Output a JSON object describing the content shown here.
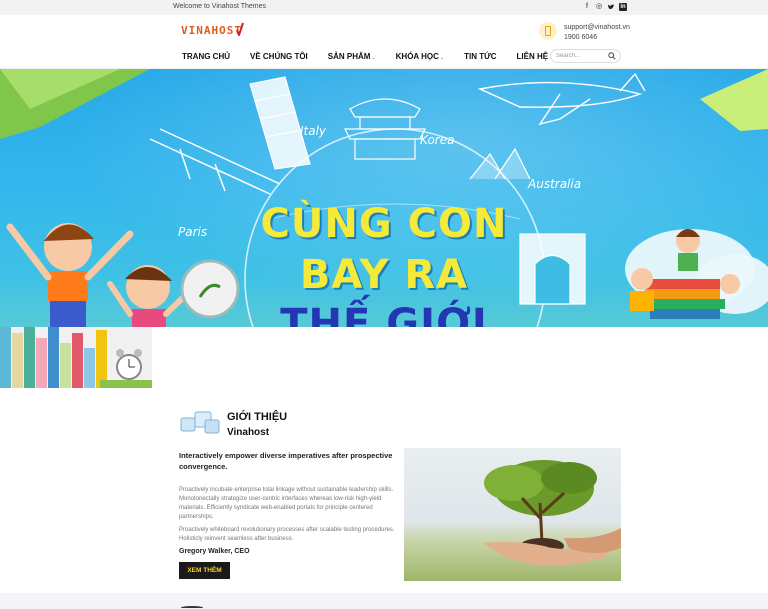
{
  "topbar": {
    "welcome": "Welcome to Vinahost Themes",
    "social": [
      {
        "icon": "facebook-icon",
        "glyph": "f"
      },
      {
        "icon": "instagram-icon",
        "glyph": "◎"
      },
      {
        "icon": "twitter-icon",
        "glyph": "🐦"
      },
      {
        "icon": "linkedin-icon",
        "glyph": "in"
      }
    ]
  },
  "header": {
    "logo_text": "VINAHOST",
    "contact": {
      "email": "support@vinahost.vn",
      "phone": "1900 6046",
      "icon": "phone-icon"
    },
    "nav": [
      {
        "label": "TRANG CHỦ",
        "has_dropdown": false
      },
      {
        "label": "VỀ CHÚNG TÔI",
        "has_dropdown": false
      },
      {
        "label": "SẢN PHẨM",
        "has_dropdown": true
      },
      {
        "label": "KHÓA HỌC",
        "has_dropdown": true
      },
      {
        "label": "TIN TỨC",
        "has_dropdown": false
      },
      {
        "label": "LIÊN HỆ",
        "has_dropdown": false
      }
    ],
    "search": {
      "placeholder": "Search...",
      "value": ""
    }
  },
  "banner": {
    "headline_line1": "CÙNG CON",
    "headline_line2": "BAY RA",
    "headline_line3": "THẾ GIỚI",
    "countries": [
      "Italy",
      "Korea",
      "Australia",
      "Paris"
    ],
    "colors": {
      "sky": "#2fb0ea",
      "headline": "#f5e93a",
      "headline_bottom": "#2437b3"
    }
  },
  "about": {
    "title": "GIỚI THIỆU",
    "subtitle": "Vinahost",
    "lead": "Interactively empower diverse imperatives after prospective convergence.",
    "paragraph1": "Proactively incubate enterprise total linkage without sustainable leadership skills. Monotonectally strategize user-centric interfaces whereas low-risk high-yield materials. Efficiently syndicate web-enabled portals for principle centered partnerships.",
    "paragraph2": "Proactively whiteboard revolutionary processes after scalable testing procedures. Holisticly reinvent seamless after business.",
    "author": "Gregory Walker, CEO",
    "button_label": "XEM THÊM",
    "button_color": "#1a1a1a",
    "button_text_color": "#f7d32c"
  }
}
